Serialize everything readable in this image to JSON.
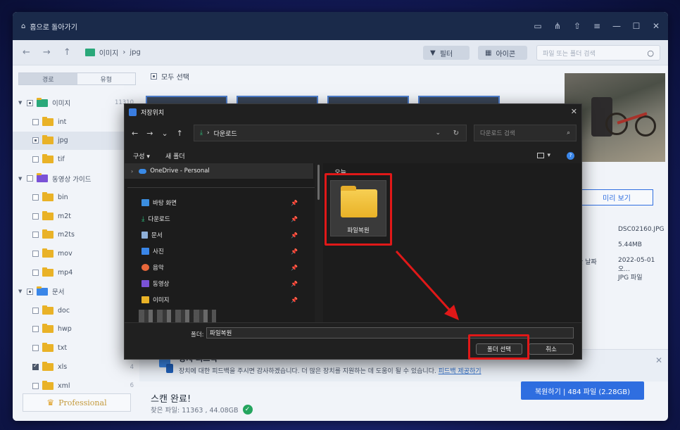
{
  "titlebar": {
    "home_label": "홈으로 돌아가기"
  },
  "nav": {
    "crumb_root": "이미지",
    "crumb_sep": "›",
    "crumb_leaf": "jpg",
    "filter_label": "필터",
    "icon_label": "아이콘",
    "search_placeholder": "파일 또는 폴더 검색"
  },
  "sidebar": {
    "tab_path": "경로",
    "tab_type": "유형",
    "rows": [
      {
        "label": "이미지",
        "count": "11310"
      },
      {
        "label": "int",
        "count": ""
      },
      {
        "label": "jpg",
        "count": "11"
      },
      {
        "label": "tif",
        "count": ""
      },
      {
        "label": "동영상 가이드",
        "count": ""
      },
      {
        "label": "bin",
        "count": ""
      },
      {
        "label": "m2t",
        "count": ""
      },
      {
        "label": "m2ts",
        "count": ""
      },
      {
        "label": "mov",
        "count": ""
      },
      {
        "label": "mp4",
        "count": ""
      },
      {
        "label": "문서",
        "count": ""
      },
      {
        "label": "doc",
        "count": ""
      },
      {
        "label": "hwp",
        "count": ""
      },
      {
        "label": "txt",
        "count": ""
      },
      {
        "label": "xls",
        "count": "4"
      },
      {
        "label": "xml",
        "count": "6"
      }
    ],
    "pro_label": "Professional"
  },
  "content": {
    "select_all": "모두 선택",
    "feedback_title": "장치 피드백",
    "feedback_desc": "장치에 대한 피드백을 주시면 감사하겠습니다. 더 많은 장치를 지원하는 데 도움이 될 수 있습니다.",
    "feedback_link": "피드백 제공하기",
    "scan_status": "스캔 완료!",
    "found_files": "찾은 파일: 11363 , 44.08GB",
    "recover_label": "복원하기 | 484 파일 (2.28GB)"
  },
  "preview": {
    "preview_btn": "미리 보기",
    "file_name": "DSC02160.JPG",
    "file_size": "5.44MB",
    "date_label": "한 날짜",
    "date_value": "2022-05-01 오...",
    "file_type": "JPG 파일"
  },
  "dialog": {
    "title": "저장위치",
    "address": "다운로드",
    "search_placeholder": "다운로드 검색",
    "organize": "구성 ▾",
    "new_folder": "새 폴더",
    "onedrive": "OneDrive - Personal",
    "quick": [
      {
        "label": "바탕 화면",
        "color": "#3b8ee0"
      },
      {
        "label": "다운로드",
        "color": "#2ec27e"
      },
      {
        "label": "문서",
        "color": "#8fb0d8"
      },
      {
        "label": "사진",
        "color": "#3a86e8"
      },
      {
        "label": "음악",
        "color": "#e8673a"
      },
      {
        "label": "동영상",
        "color": "#7a52d6"
      },
      {
        "label": "이미지",
        "color": "#e9b227"
      }
    ],
    "group_today": "오늘",
    "folder_name": "파일복원",
    "folder_field_label": "폴더:",
    "folder_field_value": "파일복원",
    "select_btn": "폴더 선택",
    "cancel_btn": "취소"
  },
  "colors": {
    "accent": "#2f6ee0",
    "annotation": "#e01818",
    "folder": "#e9b227"
  }
}
